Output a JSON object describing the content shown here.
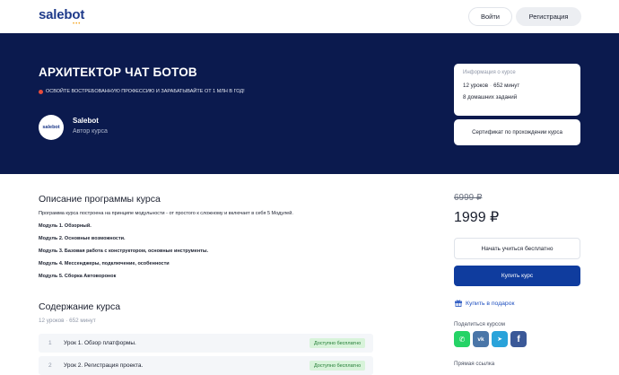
{
  "header": {
    "logo": "salebot",
    "logo_dots": "•••",
    "login": "Войти",
    "register": "Регистрация"
  },
  "hero": {
    "title": "АРХИТЕКТОР ЧАТ БОТОВ",
    "subtitle": "ОСВОЙТЕ ВОСТРЕБОВАННУЮ ПРОФЕССИЮ И ЗАРАБАТЫВАЙТЕ ОТ 1 МЛН В ГОД!",
    "author": {
      "avatar_text": "salebot",
      "name": "Salebot",
      "role": "Автор курса"
    },
    "info_card": {
      "title": "Информация о курсе",
      "lessons": "12 уроков",
      "separator": "·",
      "minutes": "652 минут",
      "homework": "8 домашних заданий"
    },
    "certificate": "Сертификат по прохождении курса"
  },
  "description": {
    "title": "Описание программы курса",
    "intro": "Программа курса построена на принципе модульности - от простого к сложному и включает в себя 5 Модулей.",
    "modules": [
      "Модуль 1. Обзорный.",
      "Модуль 2. Основные возможности.",
      "Модуль 3. Базовая работа с конструктором, основные инструменты.",
      "Модуль 4. Мессенджеры, подключение, особенности",
      "Модуль 5. Сборка Автоворонок"
    ]
  },
  "contents": {
    "title": "Содержание курса",
    "meta": "12 уроков · 652 минут",
    "lessons": [
      {
        "num": "1",
        "title": "Урок 1. Обзор платформы.",
        "badge": "Доступно бесплатно"
      },
      {
        "num": "2",
        "title": "Урок 2. Регистрация проекта.",
        "badge": "Доступно бесплатно"
      }
    ]
  },
  "pricing": {
    "old_price": "6999 ₽",
    "price": "1999 ₽",
    "start_free": "Начать учиться бесплатно",
    "buy": "Купить курс",
    "gift": "Купить в подарок"
  },
  "share": {
    "label": "Поделиться курсом",
    "networks": [
      {
        "name": "whatsapp",
        "glyph": "✆",
        "color": "#25d366"
      },
      {
        "name": "vk",
        "glyph": "vk",
        "color": "#4a76a8"
      },
      {
        "name": "telegram",
        "glyph": "➤",
        "color": "#2aa3da"
      },
      {
        "name": "facebook",
        "glyph": "f",
        "color": "#3b5998"
      }
    ],
    "direct_link": "Прямая ссылка"
  }
}
